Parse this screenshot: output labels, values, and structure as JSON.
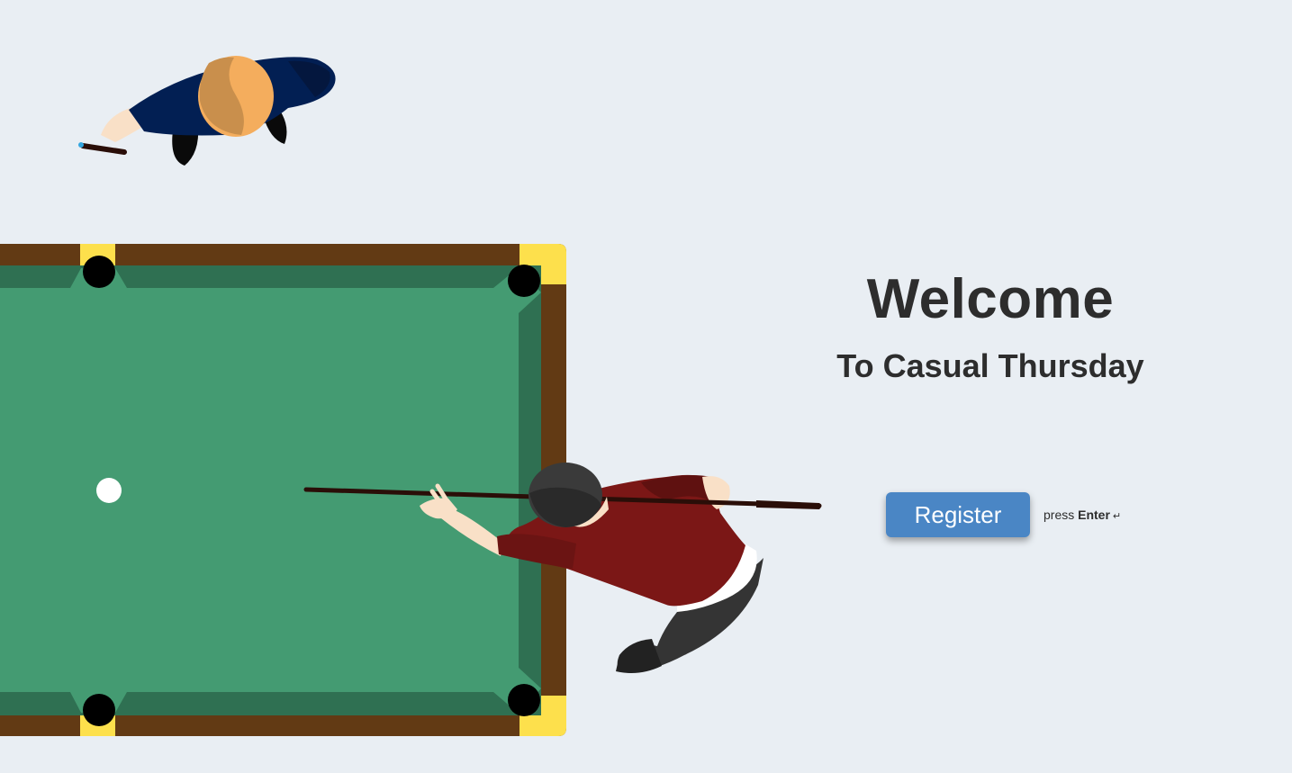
{
  "welcome": {
    "title": "Welcome",
    "subtitle": "To Casual Thursday"
  },
  "register": {
    "button_label": "Register",
    "hint_prefix": "press",
    "hint_key": "Enter",
    "hint_icon": "↵"
  },
  "colors": {
    "background": "#e9eef3",
    "table_felt": "#449b72",
    "table_cushion": "#2f7052",
    "table_rail": "#623a14",
    "pocket_corner": "#fde04c",
    "button": "#4a86c5",
    "player_shirt": "#7b1716",
    "opponent_shirt": "#021f53"
  },
  "icons": {
    "enter": "enter-key-icon",
    "cue_ball": "cue-ball-icon"
  }
}
